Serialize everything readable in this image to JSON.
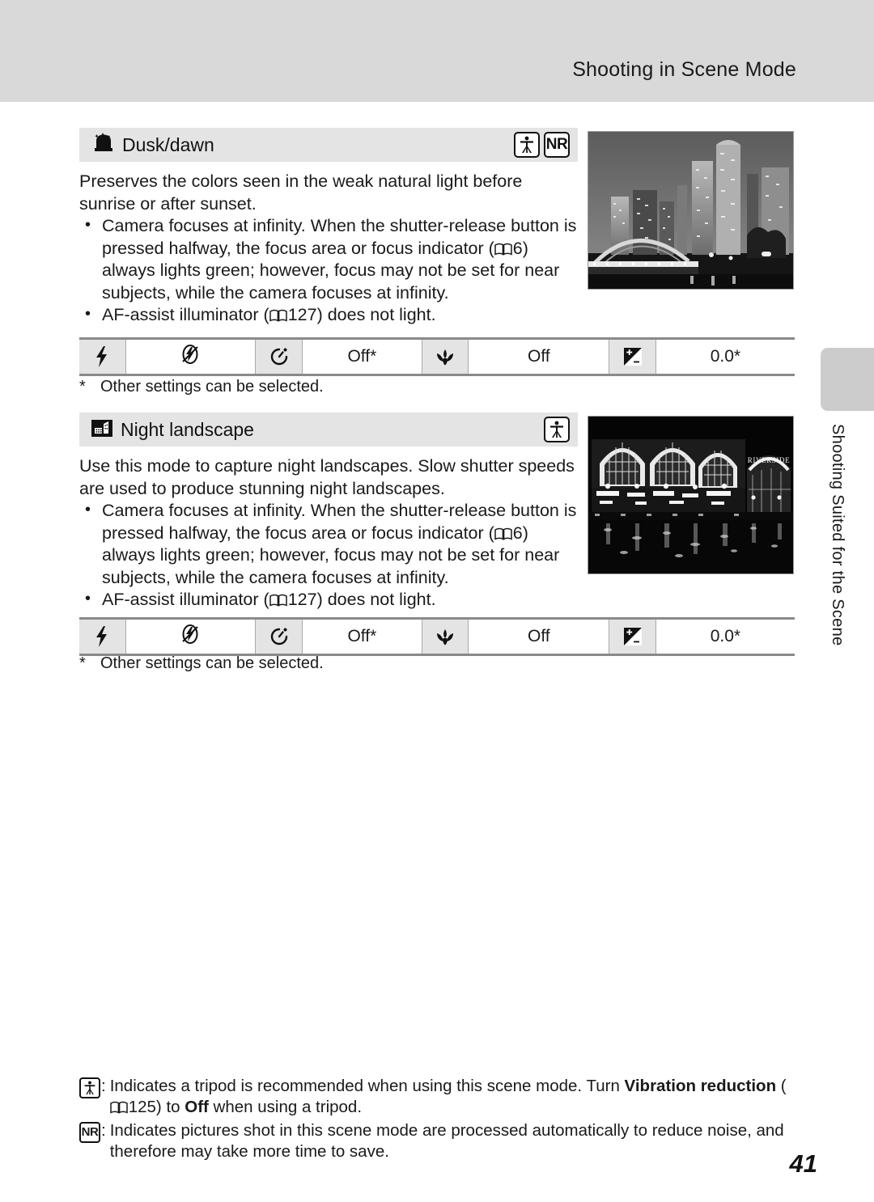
{
  "header": {
    "title": "Shooting in Scene Mode"
  },
  "side_tab": {
    "label": "Shooting Suited for the Scene"
  },
  "page_number": "41",
  "sections": [
    {
      "id": "dusk-dawn",
      "icon": "dusk-dawn-scene-icon",
      "title": "Dusk/dawn",
      "badges": [
        "tripod-icon",
        "nr-badge"
      ],
      "intro": "Preserves the colors seen in the weak natural light before sunrise or after sunset.",
      "bullets": [
        {
          "pre": "Camera focuses at infinity. When the shutter-release button is pressed halfway, the focus area or focus indicator (",
          "ref": "6",
          "post": ") always lights green; however, focus may not be set for near subjects, while the camera focuses at infinity."
        },
        {
          "pre": "AF-assist illuminator (",
          "ref": "127",
          "post": ") does not light."
        }
      ],
      "photo": "dusk-cityscape-bridge-photo",
      "settings": [
        {
          "icon": "flash-icon",
          "value_icon": "flash-off-icon",
          "value": ""
        },
        {
          "icon": "self-timer-icon",
          "value": "Off*"
        },
        {
          "icon": "macro-icon",
          "value": "Off"
        },
        {
          "icon": "exposure-compensation-icon",
          "value": "0.0*"
        }
      ],
      "footnote": "Other settings can be selected."
    },
    {
      "id": "night-landscape",
      "icon": "night-landscape-scene-icon",
      "title": "Night landscape",
      "badges": [
        "tripod-icon"
      ],
      "intro": "Use this mode to capture night landscapes. Slow shutter speeds are used to produce stunning night landscapes.",
      "bullets": [
        {
          "pre": "Camera focuses at infinity. When the shutter-release button is pressed halfway, the focus area or focus indicator (",
          "ref": "6",
          "post": ") always lights green; however, focus may not be set for near subjects, while the camera focuses at infinity."
        },
        {
          "pre": "AF-assist illuminator (",
          "ref": "127",
          "post": ") does not light."
        }
      ],
      "photo": "night-riverside-buildings-photo",
      "settings": [
        {
          "icon": "flash-icon",
          "value_icon": "flash-off-icon",
          "value": ""
        },
        {
          "icon": "self-timer-icon",
          "value": "Off*"
        },
        {
          "icon": "macro-icon",
          "value": "Off"
        },
        {
          "icon": "exposure-compensation-icon",
          "value": "0.0*"
        }
      ],
      "footnote": "Other settings can be selected."
    }
  ],
  "bottom_notes": [
    {
      "badge": "tripod-icon",
      "colon": ":",
      "text_a": "Indicates a tripod is recommended when using this scene mode. Turn ",
      "bold_a": "Vibration reduction",
      "text_b": " (",
      "ref": "125",
      "text_c": ") to ",
      "bold_b": "Off",
      "text_d": " when using a tripod."
    },
    {
      "badge": "nr-badge",
      "colon": ":",
      "text_a": "Indicates pictures shot in this scene mode are processed automatically to reduce noise, and therefore may take more time to save.",
      "bold_a": "",
      "text_b": "",
      "ref": "",
      "text_c": "",
      "bold_b": "",
      "text_d": ""
    }
  ],
  "footnote_marker": "*",
  "nr_label": "NR",
  "colors": {
    "header_band": "#d9d9d9",
    "section_header": "#e4e4e4",
    "table_icon_cell": "#e4e4e4",
    "table_rule": "#8a8a8a",
    "side_tab": "#cccccc"
  }
}
